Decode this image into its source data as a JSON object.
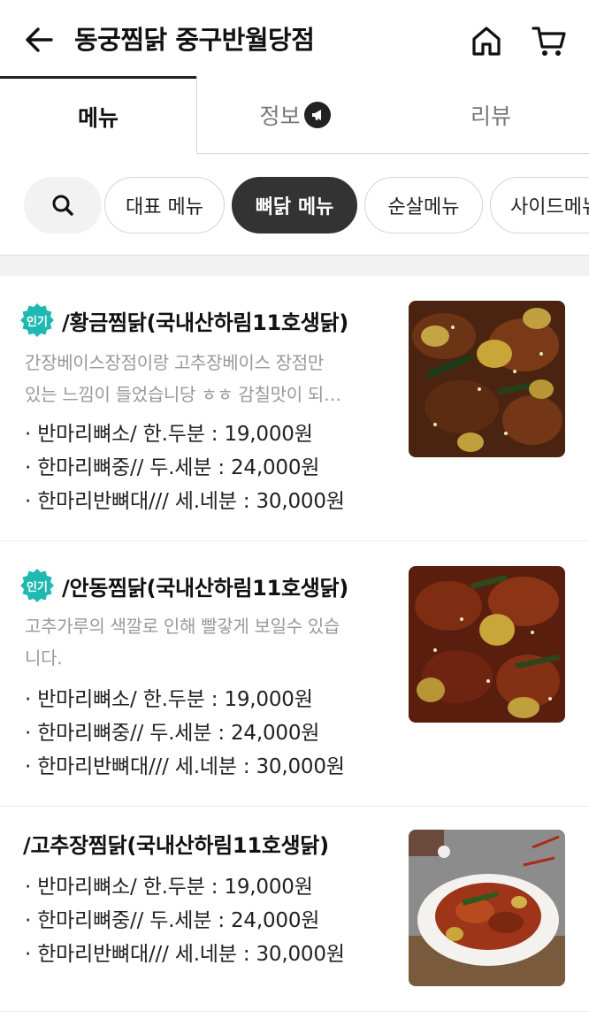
{
  "header": {
    "title": "동궁찜닭 중구반월당점"
  },
  "tabs": [
    {
      "label": "메뉴"
    },
    {
      "label": "정보"
    },
    {
      "label": "리뷰"
    }
  ],
  "categories": [
    {
      "label": "대표 메뉴"
    },
    {
      "label": "뼈닭 메뉴"
    },
    {
      "label": "순살메뉴"
    },
    {
      "label": "사이드메뉴"
    }
  ],
  "items": [
    {
      "badge": "인기",
      "name": "/황금찜닭(국내산하림11호생닭)",
      "desc_line1": "간장베이스장점이랑 고추장베이스 장점만",
      "desc_line2": "있는 느낌이 들었습니당 ㅎㅎ 감칠맛이 되…",
      "prices": [
        "· 반마리뼈소/ 한.두분 : 19,000원",
        "· 한마리뼈중// 두.세분 : 24,000원",
        "· 한마리반뼈대/// 세.네분 : 30,000원"
      ]
    },
    {
      "badge": "인기",
      "name": "/안동찜닭(국내산하림11호생닭)",
      "desc_line1": "고추가루의 색깔로 인해 빨갛게 보일수 있습",
      "desc_line2": "니다.",
      "prices": [
        "· 반마리뼈소/ 한.두분 : 19,000원",
        "· 한마리뼈중// 두.세분 : 24,000원",
        "· 한마리반뼈대/// 세.네분 : 30,000원"
      ]
    },
    {
      "name": "/고추장찜닭(국내산하림11호생닭)",
      "prices": [
        "· 반마리뼈소/ 한.두분 : 19,000원",
        "· 한마리뼈중// 두.세분 : 24,000원",
        "· 한마리반뼈대/// 세.네분 : 30,000원"
      ]
    }
  ],
  "colors": {
    "badge": "#20b9b1",
    "active_chip": "#333333",
    "desc_text": "#999999"
  },
  "icons": [
    "back-arrow-icon",
    "home-icon",
    "cart-icon",
    "megaphone-icon",
    "search-icon",
    "popular-badge-icon"
  ]
}
